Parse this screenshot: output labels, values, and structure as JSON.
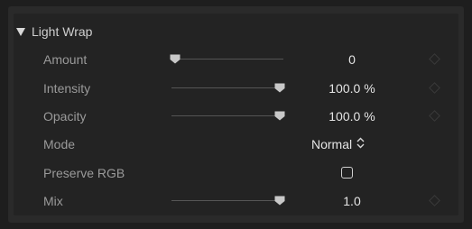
{
  "header": {
    "title": "Light Wrap",
    "disclosure_icon": "disclosure-triangle-down-icon"
  },
  "rows": {
    "amount": {
      "label": "Amount",
      "value": "0",
      "slider_fraction": 0.0
    },
    "intensity": {
      "label": "Intensity",
      "value": "100.0",
      "unit": "%",
      "slider_fraction": 1.0
    },
    "opacity": {
      "label": "Opacity",
      "value": "100.0",
      "unit": "%",
      "slider_fraction": 1.0
    },
    "mode": {
      "label": "Mode",
      "value": "Normal",
      "icon": "up-down-chevron-icon"
    },
    "preserve_rgb": {
      "label": "Preserve RGB",
      "checked": false
    },
    "mix": {
      "label": "Mix",
      "value": "1.0",
      "slider_fraction": 1.0
    }
  },
  "keyframe_icon": "keyframe-diamond-icon",
  "colors": {
    "background": "#1e1e1e",
    "panel": "#232323",
    "label_text": "#9a9a9a",
    "value_text": "#e4e4e4"
  }
}
